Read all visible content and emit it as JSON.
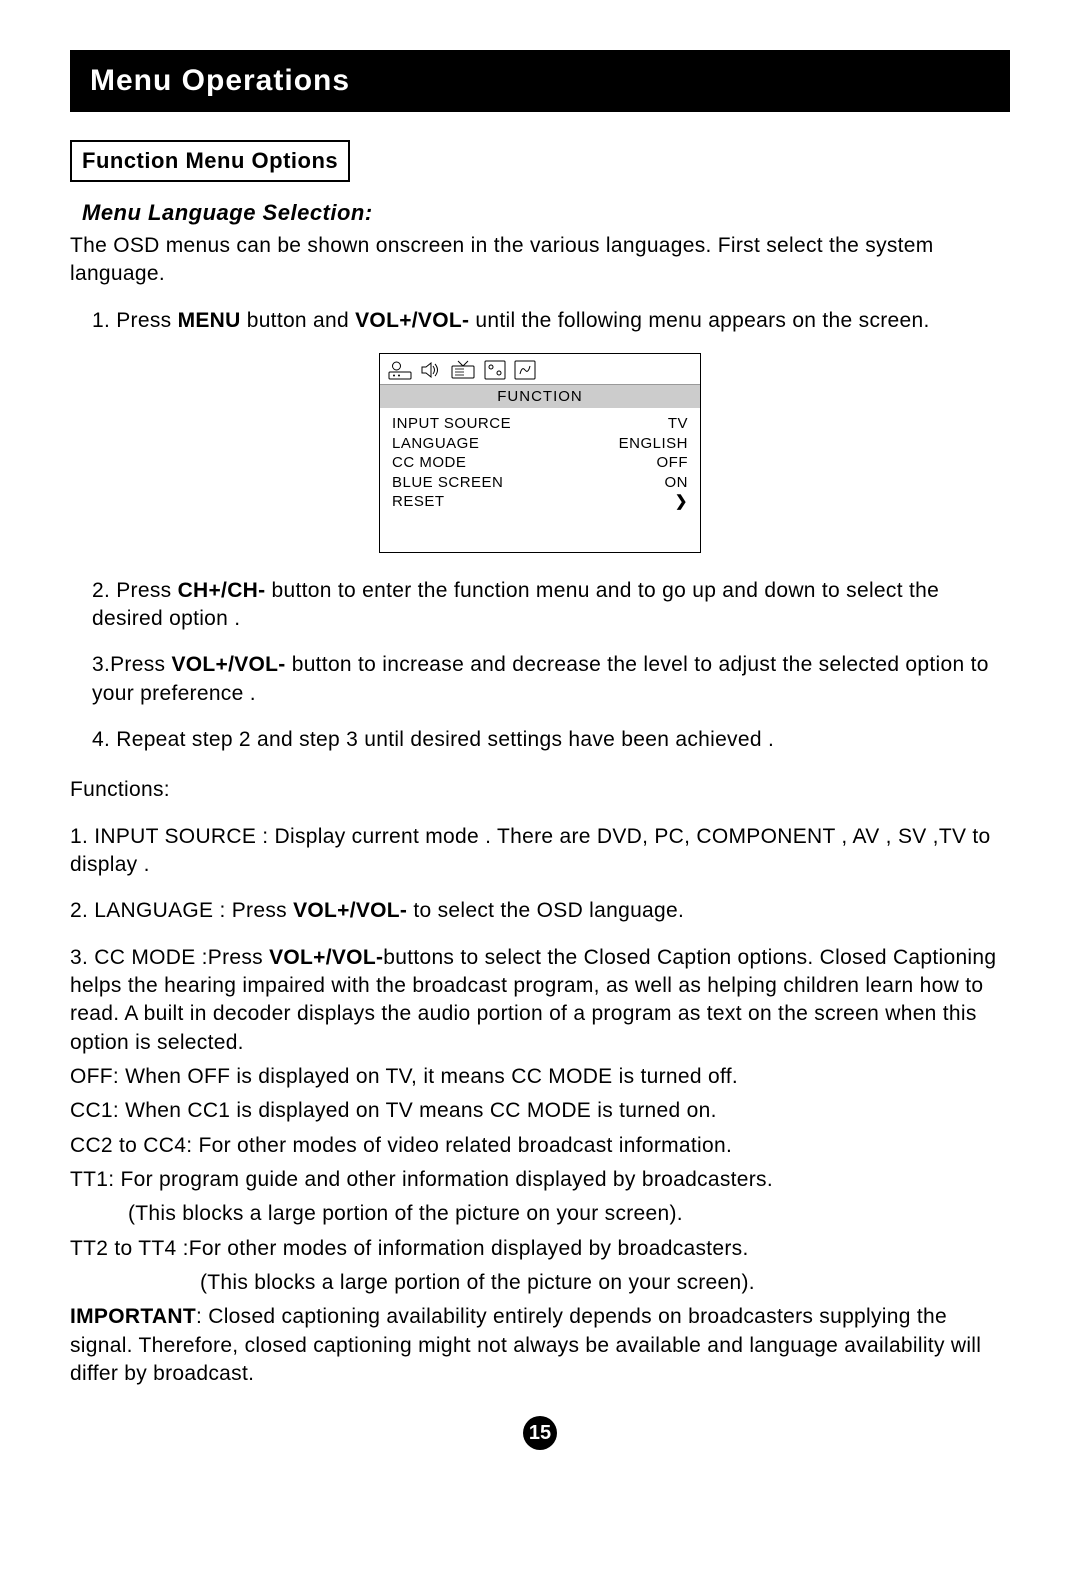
{
  "title": "Menu Operations",
  "section_label": "Function Menu Options",
  "sub_heading": "Menu Language Selection:",
  "intro": "The OSD menus can be shown onscreen in the various languages. First select the system language.",
  "step1_pre": "1. Press ",
  "step1_bold1": "MENU",
  "step1_mid1": " button and ",
  "step1_bold2": "VOL+/VOL-",
  "step1_post": " until the following menu appears on the screen.",
  "menu": {
    "header": "FUNCTION",
    "rows": [
      {
        "label": "INPUT SOURCE",
        "value": "TV"
      },
      {
        "label": "LANGUAGE",
        "value": "ENGLISH"
      },
      {
        "label": "CC MODE",
        "value": "OFF"
      },
      {
        "label": "BLUE SCREEN",
        "value": "ON"
      },
      {
        "label": "RESET",
        "value": "❯"
      }
    ]
  },
  "step2_pre": "2. Press ",
  "step2_bold": "CH+/CH-",
  "step2_post": " button to enter the function menu and to go up and down to select the desired option .",
  "step3_pre": "3.Press ",
  "step3_bold": "VOL+/VOL-",
  "step3_post": " button to increase and decrease the level to adjust the selected option to your preference .",
  "step4": "4. Repeat step 2 and step 3 until desired settings have been achieved .",
  "functions_label": "Functions:",
  "fn1": "1. INPUT SOURCE : Display current mode . There are DVD, PC, COMPONENT , AV , SV ,TV  to display .",
  "fn2_pre": "2. LANGUAGE : Press ",
  "fn2_bold": "VOL+/VOL-",
  "fn2_post": " to select the OSD language.",
  "fn3_pre": "3. CC MODE :Press ",
  "fn3_bold": "VOL+/VOL-",
  "fn3_post": "buttons to select the Closed Caption options. Closed Captioning helps the hearing impaired with the broadcast program, as well as helping children learn how to read.  A built in decoder displays the audio portion of a program as text on the screen when this  option is selected.",
  "cc_off": "OFF:  When OFF is displayed on TV, it means CC MODE is turned off.",
  "cc_cc1": "CC1:  When CC1 is displayed on TV means CC MODE is turned on.",
  "cc_cc2": "CC2 to CC4: For other modes of video related broadcast information.",
  "cc_tt1": "TT1: For program guide and other information displayed by broadcasters.",
  "cc_tt1_note": "(This blocks a large portion of the picture on your screen).",
  "cc_tt2": "TT2 to TT4 :For other modes of information displayed by broadcasters.",
  "cc_tt2_note": "(This blocks a large portion of the picture on your screen).",
  "important_label": "IMPORTANT",
  "important_text": ": Closed captioning availability entirely depends on broadcasters supplying the signal. Therefore, closed captioning might not always be available and language availability will differ by broadcast.",
  "page_number": "15"
}
